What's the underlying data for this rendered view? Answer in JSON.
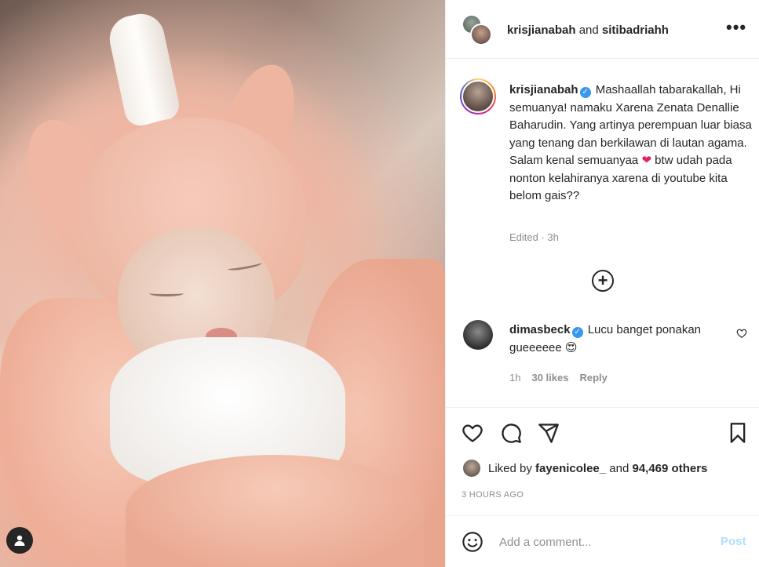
{
  "header": {
    "user1": "krisjianabah",
    "conj": " and ",
    "user2": "sitibadriahh",
    "more": "•••"
  },
  "caption": {
    "username": "krisjianabah",
    "text_part1": " Mashaallah tabarakallah, Hi semuanya! namaku Xarena Zenata Denallie Baharudin. Yang artinya perempuan luar biasa yang tenang dan berkilawan di lautan agama. Salam kenal semuanyaa ",
    "heart": "❤",
    "text_part2": " btw udah pada nonton kelahiranya xarena di youtube kita belom gais??",
    "meta": "Edited · 3h"
  },
  "load_more": "+",
  "comment": {
    "username": "dimasbeck",
    "text": " Lucu banget ponakan gueeeeee ",
    "emoji": "😍",
    "time": "1h",
    "likes": "30 likes",
    "reply": "Reply"
  },
  "likes": {
    "prefix": "Liked by ",
    "user": "fayenicolee_",
    "mid": " and ",
    "others": "94,469 others"
  },
  "time_ago": "3 HOURS AGO",
  "add_comment": {
    "placeholder": "Add a comment...",
    "post": "Post"
  },
  "icons": {
    "verified": "✓"
  }
}
